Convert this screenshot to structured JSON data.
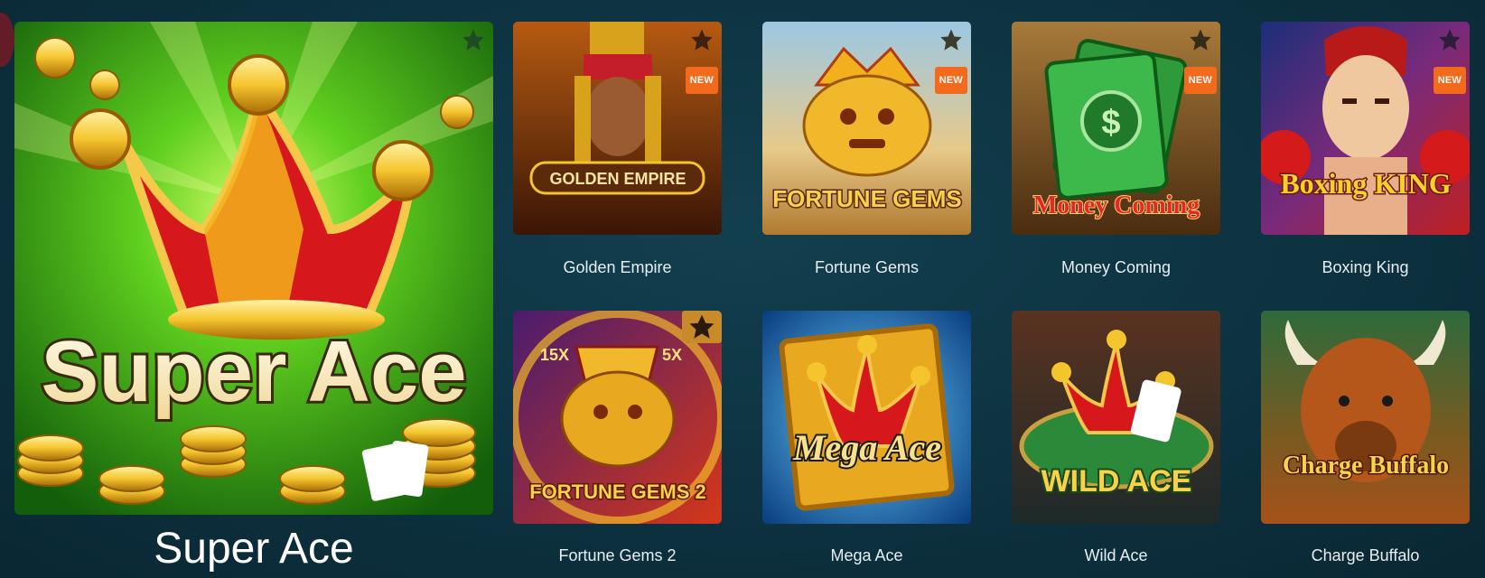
{
  "featured": {
    "name": "Super Ace",
    "logo_text": "Super Ace"
  },
  "games": [
    {
      "id": "golden-empire",
      "name": "Golden Empire",
      "logo_text": "GOLDEN EMPIRE",
      "badge": "NEW",
      "colors": [
        "#3a1606",
        "#b65a12"
      ]
    },
    {
      "id": "fortune-gems",
      "name": "Fortune Gems",
      "logo_text": "FORTUNE GEMS",
      "badge": "NEW",
      "colors": [
        "#6aa0c8",
        "#d9a24a"
      ]
    },
    {
      "id": "money-coming",
      "name": "Money Coming",
      "logo_text": "Money Coming",
      "badge": "NEW",
      "colors": [
        "#4a2c10",
        "#a77a3a"
      ]
    },
    {
      "id": "boxing-king",
      "name": "Boxing King",
      "logo_text": "Boxing KING",
      "badge": "NEW",
      "colors": [
        "#1b2f7a",
        "#c02020"
      ]
    },
    {
      "id": "fortune-gems-2",
      "name": "Fortune Gems 2",
      "logo_text": "FORTUNE GEMS 2",
      "colors": [
        "#4a1c6e",
        "#d5371a"
      ]
    },
    {
      "id": "mega-ace",
      "name": "Mega Ace",
      "logo_text": "Mega Ace",
      "colors": [
        "#0a4d8f",
        "#f0b52a"
      ]
    },
    {
      "id": "wild-ace",
      "name": "Wild Ace",
      "logo_text": "WILD ACE",
      "colors": [
        "#3a2218",
        "#2b8a3a"
      ]
    },
    {
      "id": "charge-buffalo",
      "name": "Charge Buffalo",
      "logo_text": "Charge Buffalo",
      "colors": [
        "#2e6a3c",
        "#c15a14"
      ]
    }
  ],
  "labels": {
    "new": "NEW"
  },
  "icons": {
    "favorite": "star-icon"
  },
  "wheel_text": {
    "left": "15X",
    "right": "5X"
  },
  "colors": {
    "background": "#0d3240",
    "badge": "#f26a1b",
    "text": "#e8eef2"
  }
}
